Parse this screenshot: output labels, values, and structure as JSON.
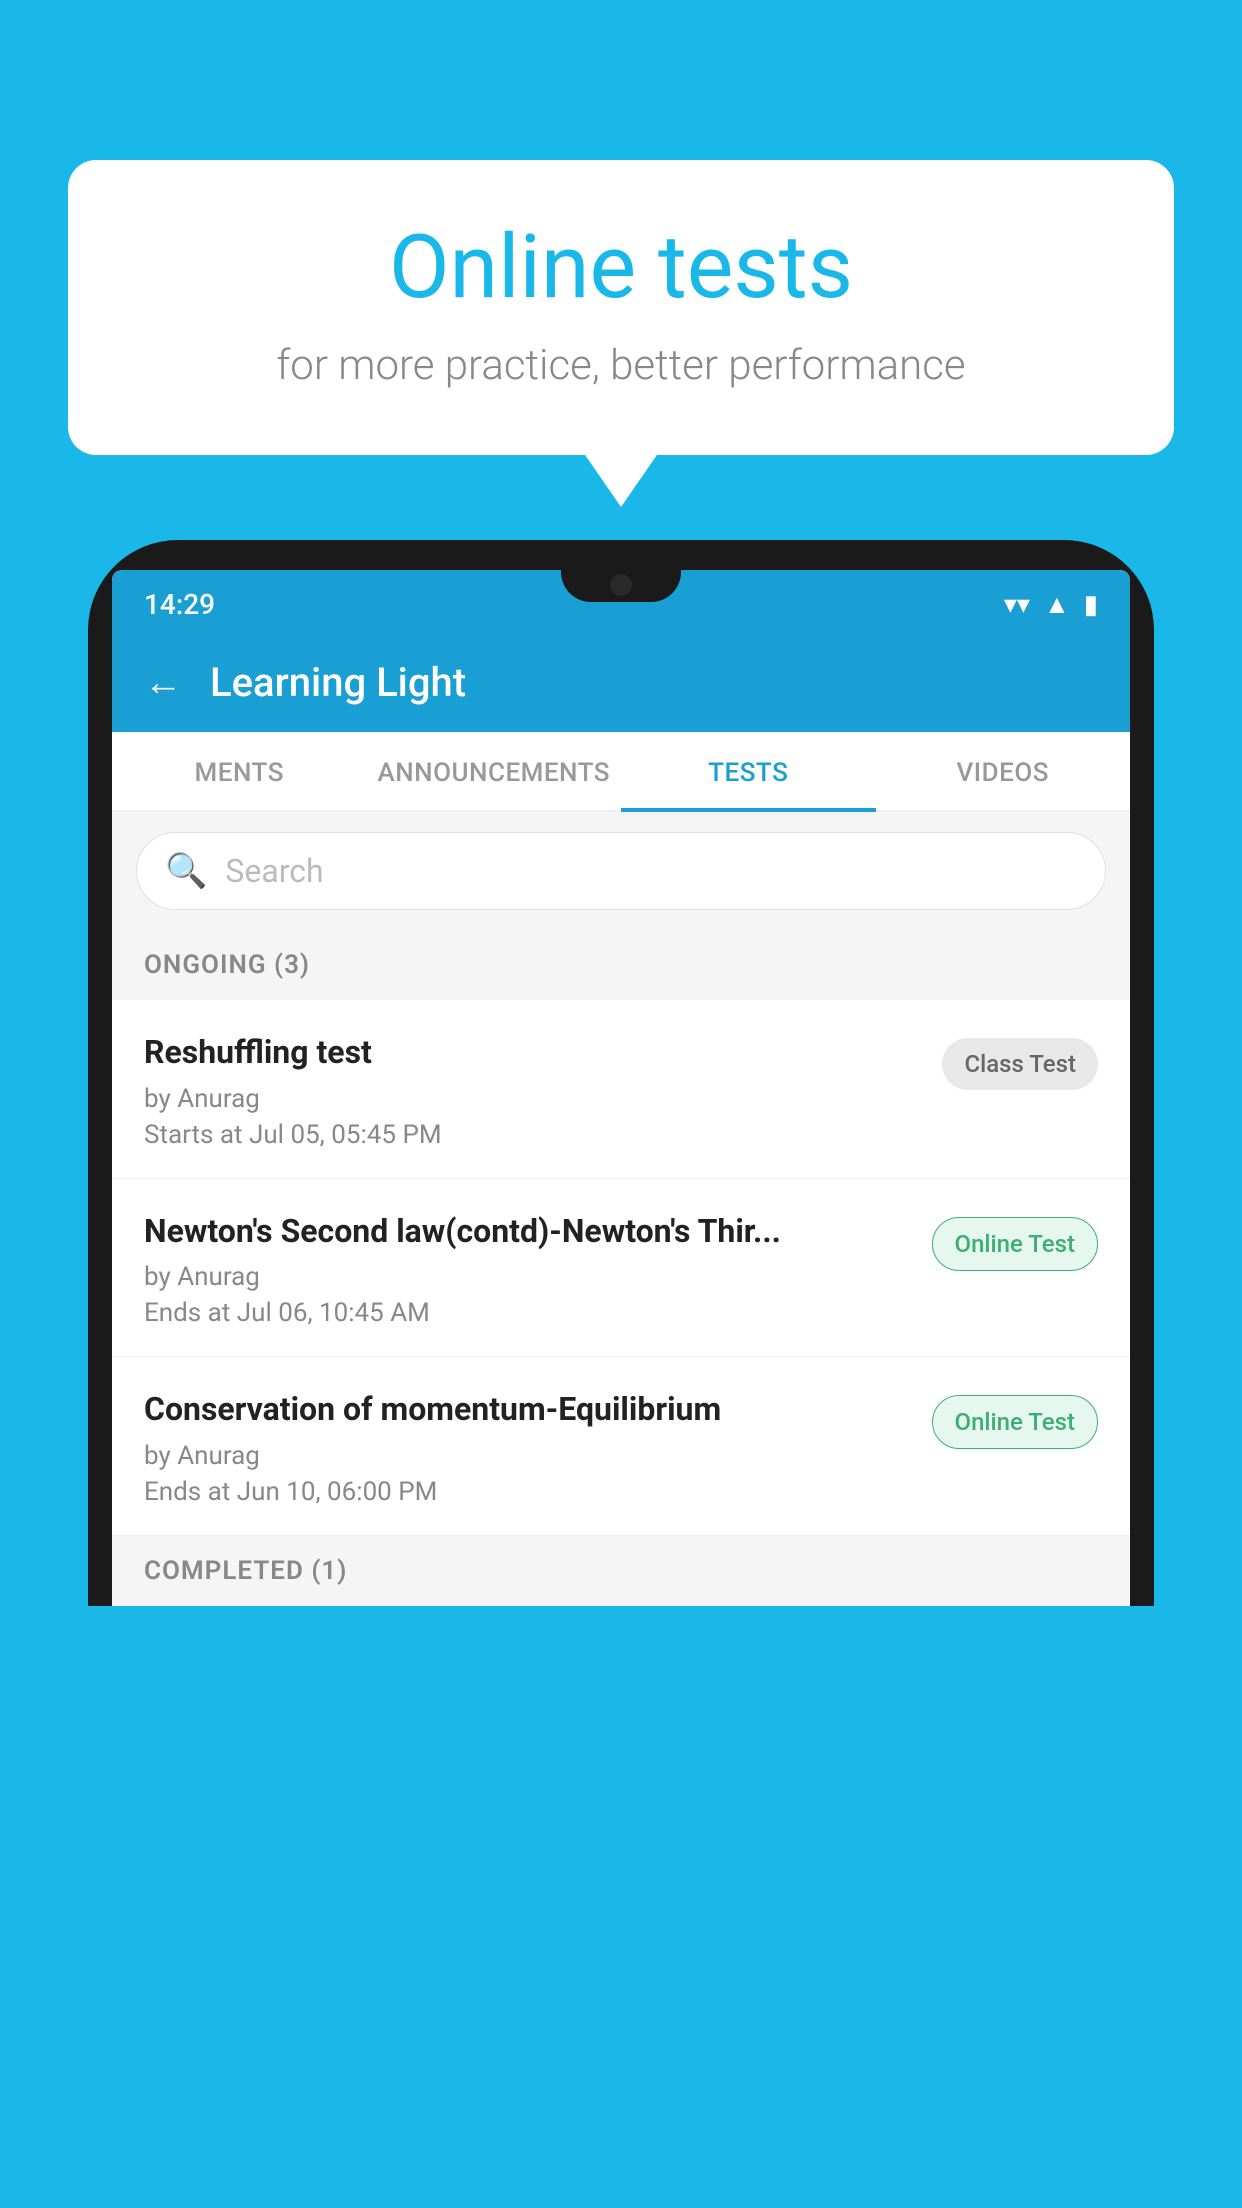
{
  "background_color": "#1ab8e8",
  "bubble": {
    "title": "Online tests",
    "subtitle": "for more practice, better performance"
  },
  "status_bar": {
    "time": "14:29",
    "icons": [
      "wifi",
      "signal",
      "battery"
    ]
  },
  "app_header": {
    "back_label": "←",
    "title": "Learning Light"
  },
  "tabs": [
    {
      "label": "MENTS",
      "active": false
    },
    {
      "label": "ANNOUNCEMENTS",
      "active": false
    },
    {
      "label": "TESTS",
      "active": true
    },
    {
      "label": "VIDEOS",
      "active": false
    }
  ],
  "search": {
    "placeholder": "Search",
    "icon": "🔍"
  },
  "ongoing_section": {
    "label": "ONGOING (3)"
  },
  "tests": [
    {
      "name": "Reshuffling test",
      "author": "by Anurag",
      "date_label": "Starts at  Jul 05, 05:45 PM",
      "badge": "Class Test",
      "badge_type": "class"
    },
    {
      "name": "Newton's Second law(contd)-Newton's Thir...",
      "author": "by Anurag",
      "date_label": "Ends at  Jul 06, 10:45 AM",
      "badge": "Online Test",
      "badge_type": "online"
    },
    {
      "name": "Conservation of momentum-Equilibrium",
      "author": "by Anurag",
      "date_label": "Ends at  Jun 10, 06:00 PM",
      "badge": "Online Test",
      "badge_type": "online"
    }
  ],
  "completed_section": {
    "label": "COMPLETED (1)"
  }
}
